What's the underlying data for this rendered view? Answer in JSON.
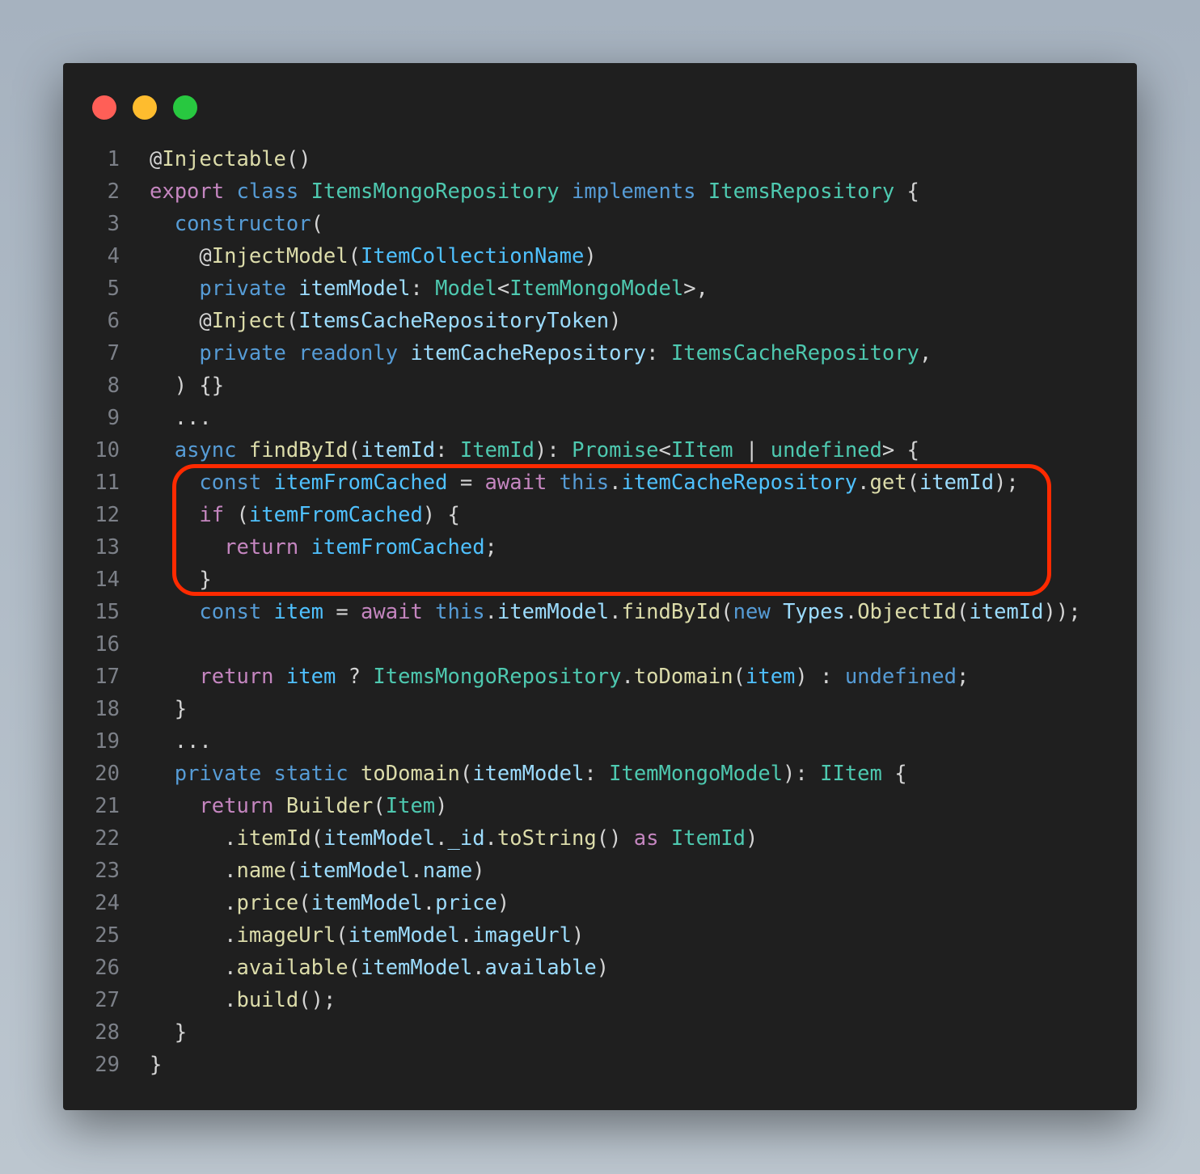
{
  "window": {
    "controls": [
      {
        "name": "close-button",
        "color": "#ff5f57"
      },
      {
        "name": "minimize-button",
        "color": "#febc2e"
      },
      {
        "name": "maximize-button",
        "color": "#28c840"
      }
    ],
    "background": "#1f1f1f",
    "highlight_color": "#ff2a00",
    "highlight_lines": [
      11,
      14
    ]
  },
  "colors": {
    "plain": "#d4d4d4",
    "keyword": "#569cd6",
    "control": "#c586c0",
    "type": "#4ec9b0",
    "function": "#dcdcaa",
    "variable": "#9cdcfe",
    "constant": "#4fc1ff"
  },
  "code": [
    [
      [
        "@",
        "n"
      ],
      [
        "Injectable",
        "f"
      ],
      [
        "()",
        "n"
      ]
    ],
    [
      [
        "export",
        "p"
      ],
      [
        " ",
        "n"
      ],
      [
        "class",
        "k"
      ],
      [
        " ",
        "n"
      ],
      [
        "ItemsMongoRepository",
        "t"
      ],
      [
        " ",
        "n"
      ],
      [
        "implements",
        "k"
      ],
      [
        " ",
        "n"
      ],
      [
        "ItemsRepository",
        "t"
      ],
      [
        " {",
        "n"
      ]
    ],
    [
      [
        "  ",
        "n"
      ],
      [
        "constructor",
        "k"
      ],
      [
        "(",
        "n"
      ]
    ],
    [
      [
        "    @",
        "n"
      ],
      [
        "InjectModel",
        "f"
      ],
      [
        "(",
        "n"
      ],
      [
        "ItemCollectionName",
        "c"
      ],
      [
        ")",
        "n"
      ]
    ],
    [
      [
        "    ",
        "n"
      ],
      [
        "private",
        "k"
      ],
      [
        " ",
        "n"
      ],
      [
        "itemModel",
        "v"
      ],
      [
        ": ",
        "n"
      ],
      [
        "Model",
        "t"
      ],
      [
        "<",
        "n"
      ],
      [
        "ItemMongoModel",
        "t"
      ],
      [
        ">,",
        "n"
      ]
    ],
    [
      [
        "    @",
        "n"
      ],
      [
        "Inject",
        "f"
      ],
      [
        "(",
        "n"
      ],
      [
        "ItemsCacheRepositoryToken",
        "v"
      ],
      [
        ")",
        "n"
      ]
    ],
    [
      [
        "    ",
        "n"
      ],
      [
        "private",
        "k"
      ],
      [
        " ",
        "n"
      ],
      [
        "readonly",
        "k"
      ],
      [
        " ",
        "n"
      ],
      [
        "itemCacheRepository",
        "v"
      ],
      [
        ": ",
        "n"
      ],
      [
        "ItemsCacheRepository",
        "t"
      ],
      [
        ",",
        "n"
      ]
    ],
    [
      [
        "  ) {}",
        "n"
      ]
    ],
    [
      [
        "  ...",
        "n"
      ]
    ],
    [
      [
        "  ",
        "n"
      ],
      [
        "async",
        "k"
      ],
      [
        " ",
        "n"
      ],
      [
        "findById",
        "f"
      ],
      [
        "(",
        "n"
      ],
      [
        "itemId",
        "v"
      ],
      [
        ": ",
        "n"
      ],
      [
        "ItemId",
        "t"
      ],
      [
        "): ",
        "n"
      ],
      [
        "Promise",
        "t"
      ],
      [
        "<",
        "n"
      ],
      [
        "IItem",
        "t"
      ],
      [
        " | ",
        "n"
      ],
      [
        "undefined",
        "t"
      ],
      [
        "> {",
        "n"
      ]
    ],
    [
      [
        "    ",
        "n"
      ],
      [
        "const",
        "k"
      ],
      [
        " ",
        "n"
      ],
      [
        "itemFromCached",
        "c"
      ],
      [
        " = ",
        "n"
      ],
      [
        "await",
        "p"
      ],
      [
        " ",
        "n"
      ],
      [
        "this",
        "k"
      ],
      [
        ".",
        "n"
      ],
      [
        "itemCacheRepository",
        "c"
      ],
      [
        ".",
        "n"
      ],
      [
        "get",
        "f"
      ],
      [
        "(",
        "n"
      ],
      [
        "itemId",
        "v"
      ],
      [
        ");",
        "n"
      ]
    ],
    [
      [
        "    ",
        "n"
      ],
      [
        "if",
        "p"
      ],
      [
        " (",
        "n"
      ],
      [
        "itemFromCached",
        "c"
      ],
      [
        ") {",
        "n"
      ]
    ],
    [
      [
        "      ",
        "n"
      ],
      [
        "return",
        "p"
      ],
      [
        " ",
        "n"
      ],
      [
        "itemFromCached",
        "c"
      ],
      [
        ";",
        "n"
      ]
    ],
    [
      [
        "    }",
        "n"
      ]
    ],
    [
      [
        "    ",
        "n"
      ],
      [
        "const",
        "k"
      ],
      [
        " ",
        "n"
      ],
      [
        "item",
        "c"
      ],
      [
        " = ",
        "n"
      ],
      [
        "await",
        "p"
      ],
      [
        " ",
        "n"
      ],
      [
        "this",
        "k"
      ],
      [
        ".",
        "n"
      ],
      [
        "itemModel",
        "v"
      ],
      [
        ".",
        "n"
      ],
      [
        "findById",
        "f"
      ],
      [
        "(",
        "n"
      ],
      [
        "new",
        "k"
      ],
      [
        " ",
        "n"
      ],
      [
        "Types",
        "v"
      ],
      [
        ".",
        "n"
      ],
      [
        "ObjectId",
        "f"
      ],
      [
        "(",
        "n"
      ],
      [
        "itemId",
        "v"
      ],
      [
        "));",
        "n"
      ]
    ],
    [],
    [
      [
        "    ",
        "n"
      ],
      [
        "return",
        "p"
      ],
      [
        " ",
        "n"
      ],
      [
        "item",
        "c"
      ],
      [
        " ? ",
        "n"
      ],
      [
        "ItemsMongoRepository",
        "t"
      ],
      [
        ".",
        "n"
      ],
      [
        "toDomain",
        "f"
      ],
      [
        "(",
        "n"
      ],
      [
        "item",
        "c"
      ],
      [
        ") : ",
        "n"
      ],
      [
        "undefined",
        "k"
      ],
      [
        ";",
        "n"
      ]
    ],
    [
      [
        "  }",
        "n"
      ]
    ],
    [
      [
        "  ...",
        "n"
      ]
    ],
    [
      [
        "  ",
        "n"
      ],
      [
        "private",
        "k"
      ],
      [
        " ",
        "n"
      ],
      [
        "static",
        "k"
      ],
      [
        " ",
        "n"
      ],
      [
        "toDomain",
        "f"
      ],
      [
        "(",
        "n"
      ],
      [
        "itemModel",
        "v"
      ],
      [
        ": ",
        "n"
      ],
      [
        "ItemMongoModel",
        "t"
      ],
      [
        "): ",
        "n"
      ],
      [
        "IItem",
        "t"
      ],
      [
        " {",
        "n"
      ]
    ],
    [
      [
        "    ",
        "n"
      ],
      [
        "return",
        "p"
      ],
      [
        " ",
        "n"
      ],
      [
        "Builder",
        "f"
      ],
      [
        "(",
        "n"
      ],
      [
        "Item",
        "t"
      ],
      [
        ")",
        "n"
      ]
    ],
    [
      [
        "      .",
        "n"
      ],
      [
        "itemId",
        "f"
      ],
      [
        "(",
        "n"
      ],
      [
        "itemModel",
        "v"
      ],
      [
        ".",
        "n"
      ],
      [
        "_id",
        "v"
      ],
      [
        ".",
        "n"
      ],
      [
        "toString",
        "f"
      ],
      [
        "() ",
        "n"
      ],
      [
        "as",
        "p"
      ],
      [
        " ",
        "n"
      ],
      [
        "ItemId",
        "t"
      ],
      [
        ")",
        "n"
      ]
    ],
    [
      [
        "      .",
        "n"
      ],
      [
        "name",
        "f"
      ],
      [
        "(",
        "n"
      ],
      [
        "itemModel",
        "v"
      ],
      [
        ".",
        "n"
      ],
      [
        "name",
        "v"
      ],
      [
        ")",
        "n"
      ]
    ],
    [
      [
        "      .",
        "n"
      ],
      [
        "price",
        "f"
      ],
      [
        "(",
        "n"
      ],
      [
        "itemModel",
        "v"
      ],
      [
        ".",
        "n"
      ],
      [
        "price",
        "v"
      ],
      [
        ")",
        "n"
      ]
    ],
    [
      [
        "      .",
        "n"
      ],
      [
        "imageUrl",
        "f"
      ],
      [
        "(",
        "n"
      ],
      [
        "itemModel",
        "v"
      ],
      [
        ".",
        "n"
      ],
      [
        "imageUrl",
        "v"
      ],
      [
        ")",
        "n"
      ]
    ],
    [
      [
        "      .",
        "n"
      ],
      [
        "available",
        "f"
      ],
      [
        "(",
        "n"
      ],
      [
        "itemModel",
        "v"
      ],
      [
        ".",
        "n"
      ],
      [
        "available",
        "v"
      ],
      [
        ")",
        "n"
      ]
    ],
    [
      [
        "      .",
        "n"
      ],
      [
        "build",
        "f"
      ],
      [
        "();",
        "n"
      ]
    ],
    [
      [
        "  }",
        "n"
      ]
    ],
    [
      [
        "}",
        "n"
      ]
    ]
  ]
}
